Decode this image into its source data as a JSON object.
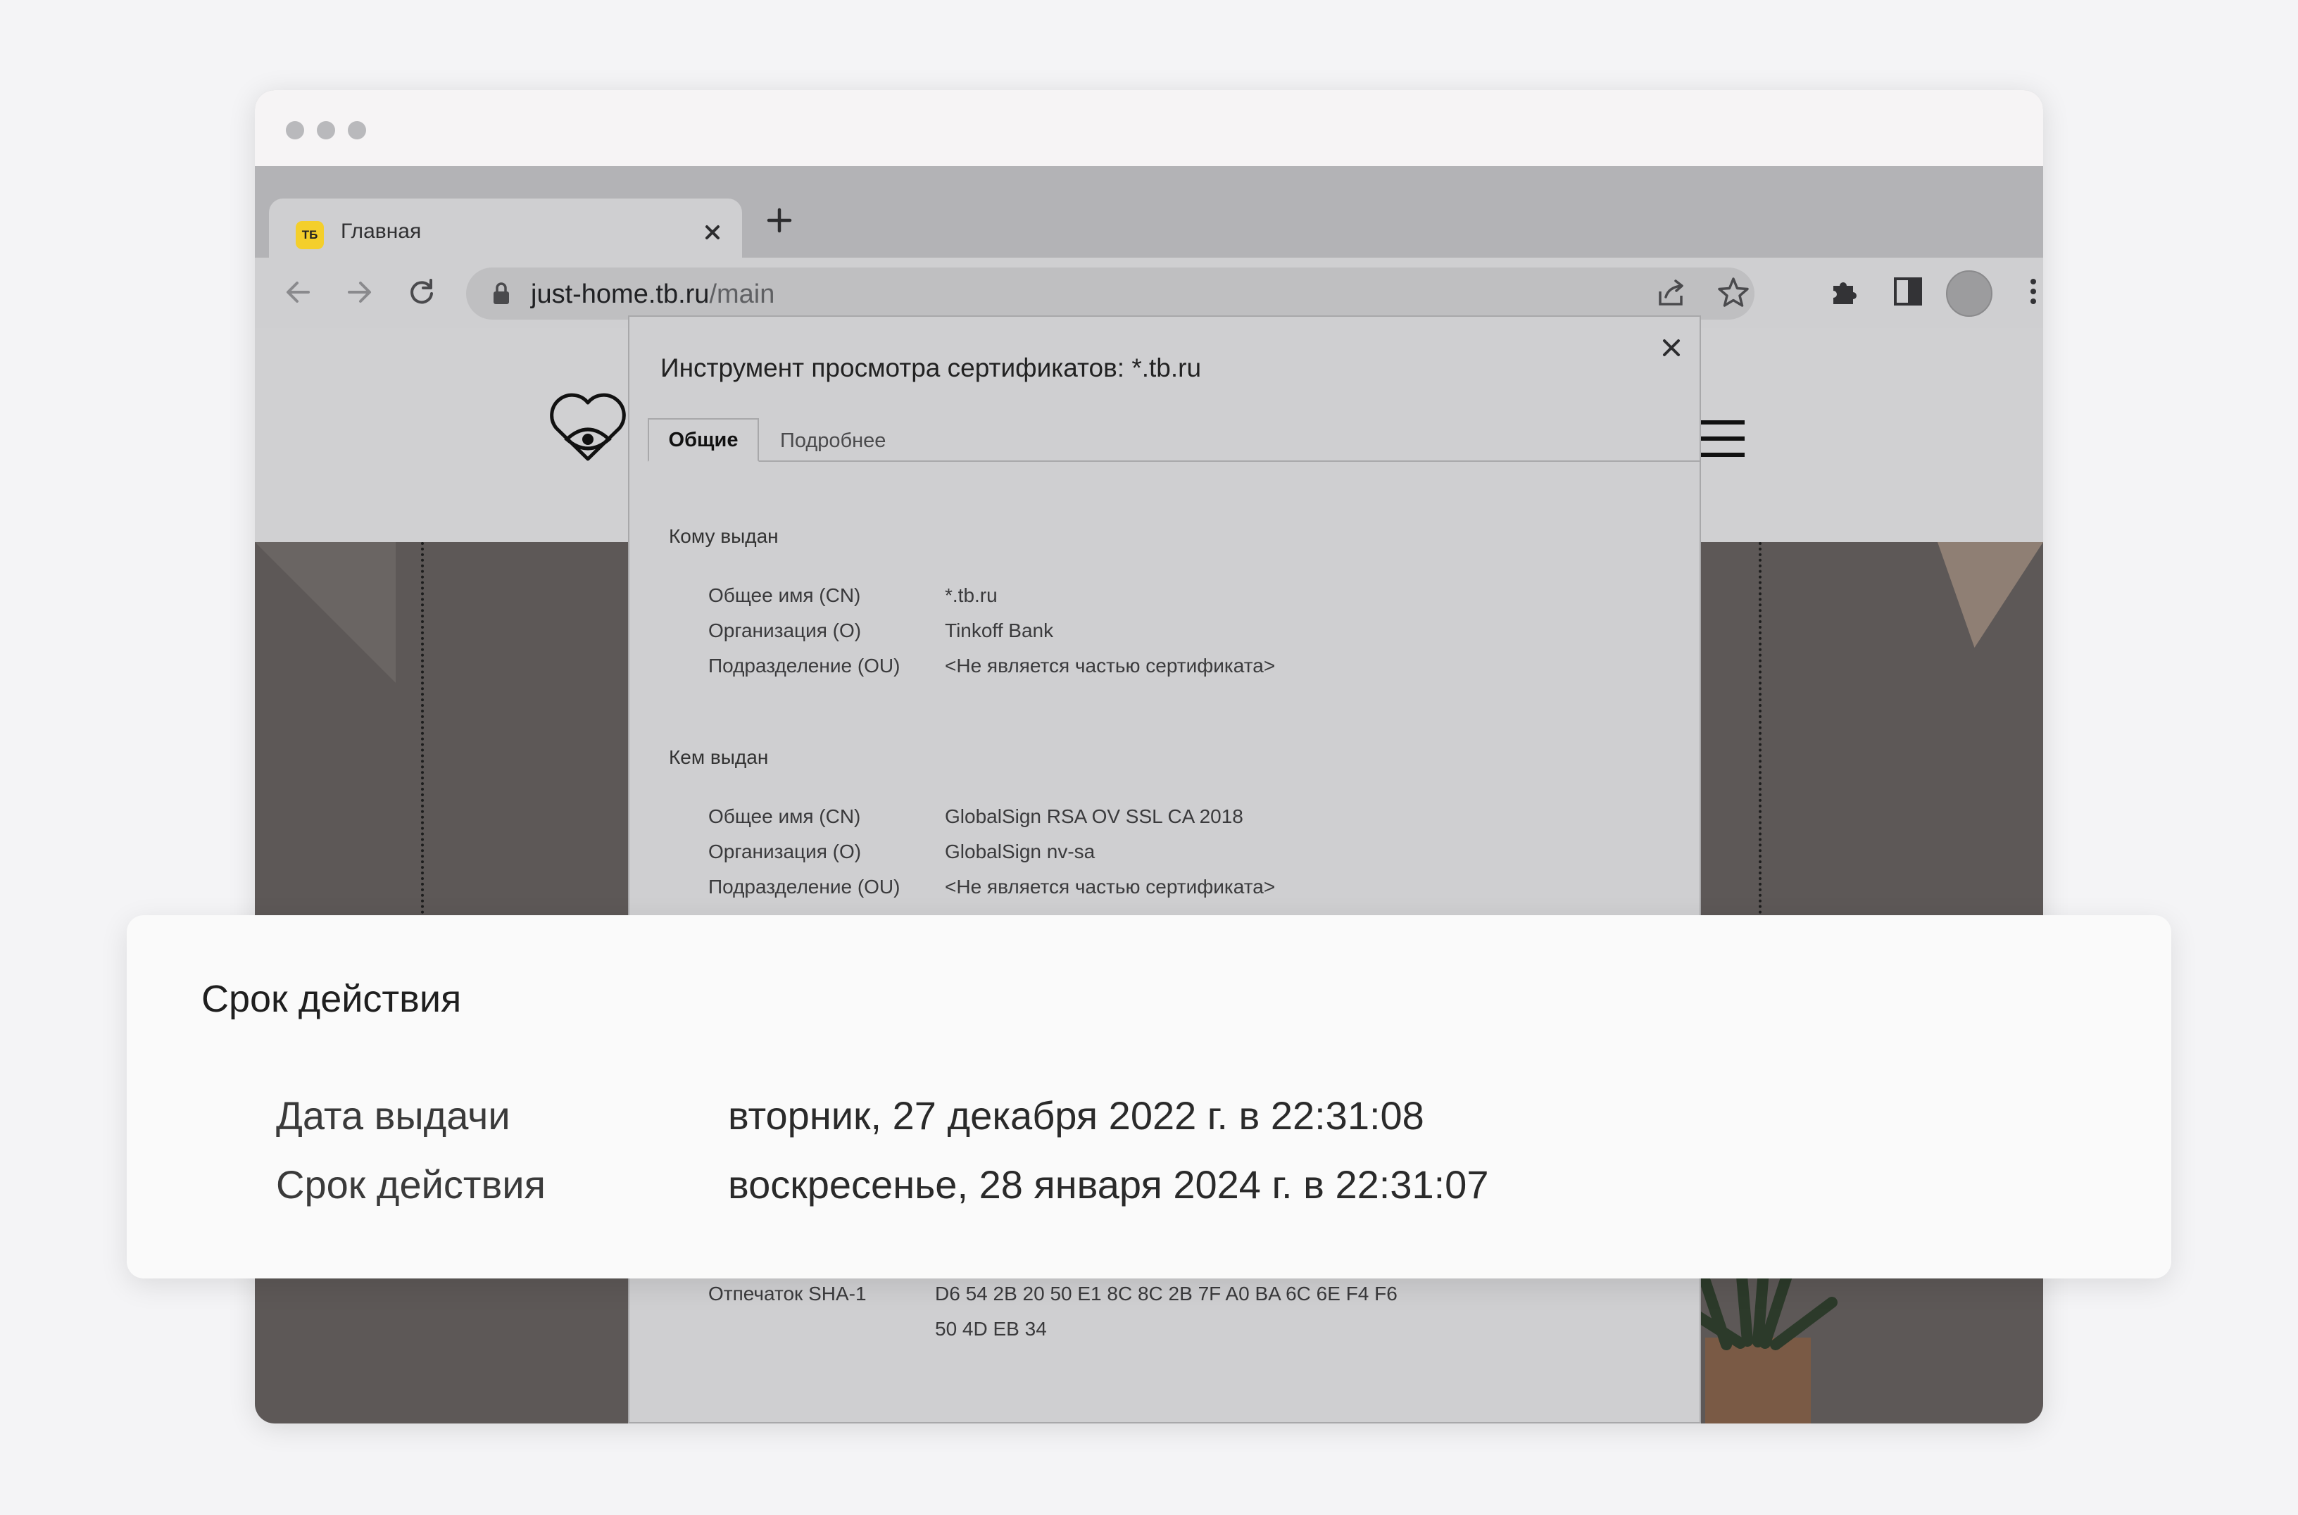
{
  "browser": {
    "tab": {
      "favicon_text": "ТБ",
      "title": "Главная"
    },
    "url": {
      "host": "just-home.tb.ru",
      "path": "/main"
    }
  },
  "dialog": {
    "title": "Инструмент просмотра сертификатов: *.tb.ru",
    "tabs": [
      "Общие",
      "Подробнее"
    ],
    "issued_to": {
      "heading": "Кому выдан",
      "rows": [
        {
          "label": "Общее имя (CN)",
          "value": "*.tb.ru"
        },
        {
          "label": "Организация (O)",
          "value": "Tinkoff Bank"
        },
        {
          "label": "Подразделение (OU)",
          "value": "<Не является частью сертификата>"
        }
      ]
    },
    "issued_by": {
      "heading": "Кем выдан",
      "rows": [
        {
          "label": "Общее имя (CN)",
          "value": "GlobalSign RSA OV SSL CA 2018"
        },
        {
          "label": "Организация (O)",
          "value": "GlobalSign nv-sa"
        },
        {
          "label": "Подразделение (OU)",
          "value": "<Не является частью сертификата>"
        }
      ]
    },
    "fingerprint": {
      "label": "Отпечаток SHA-1",
      "line1": "D6 54 2B 20 50 E1 8C 8C 2B 7F A0 BA 6C 6E F4 F6",
      "line2": "50 4D EB 34"
    }
  },
  "validity_card": {
    "title": "Срок действия",
    "rows": [
      {
        "label": "Дата выдачи",
        "value": "вторник, 27 декабря 2022 г. в 22:31:08"
      },
      {
        "label": "Срок действия",
        "value": "воскресенье, 28 января 2024 г. в 22:31:07"
      }
    ]
  },
  "colors": {
    "favicon_bg": "#f4cf2b",
    "dimmed_page": "#cfcfd1",
    "card_bg": "#fafafa"
  }
}
